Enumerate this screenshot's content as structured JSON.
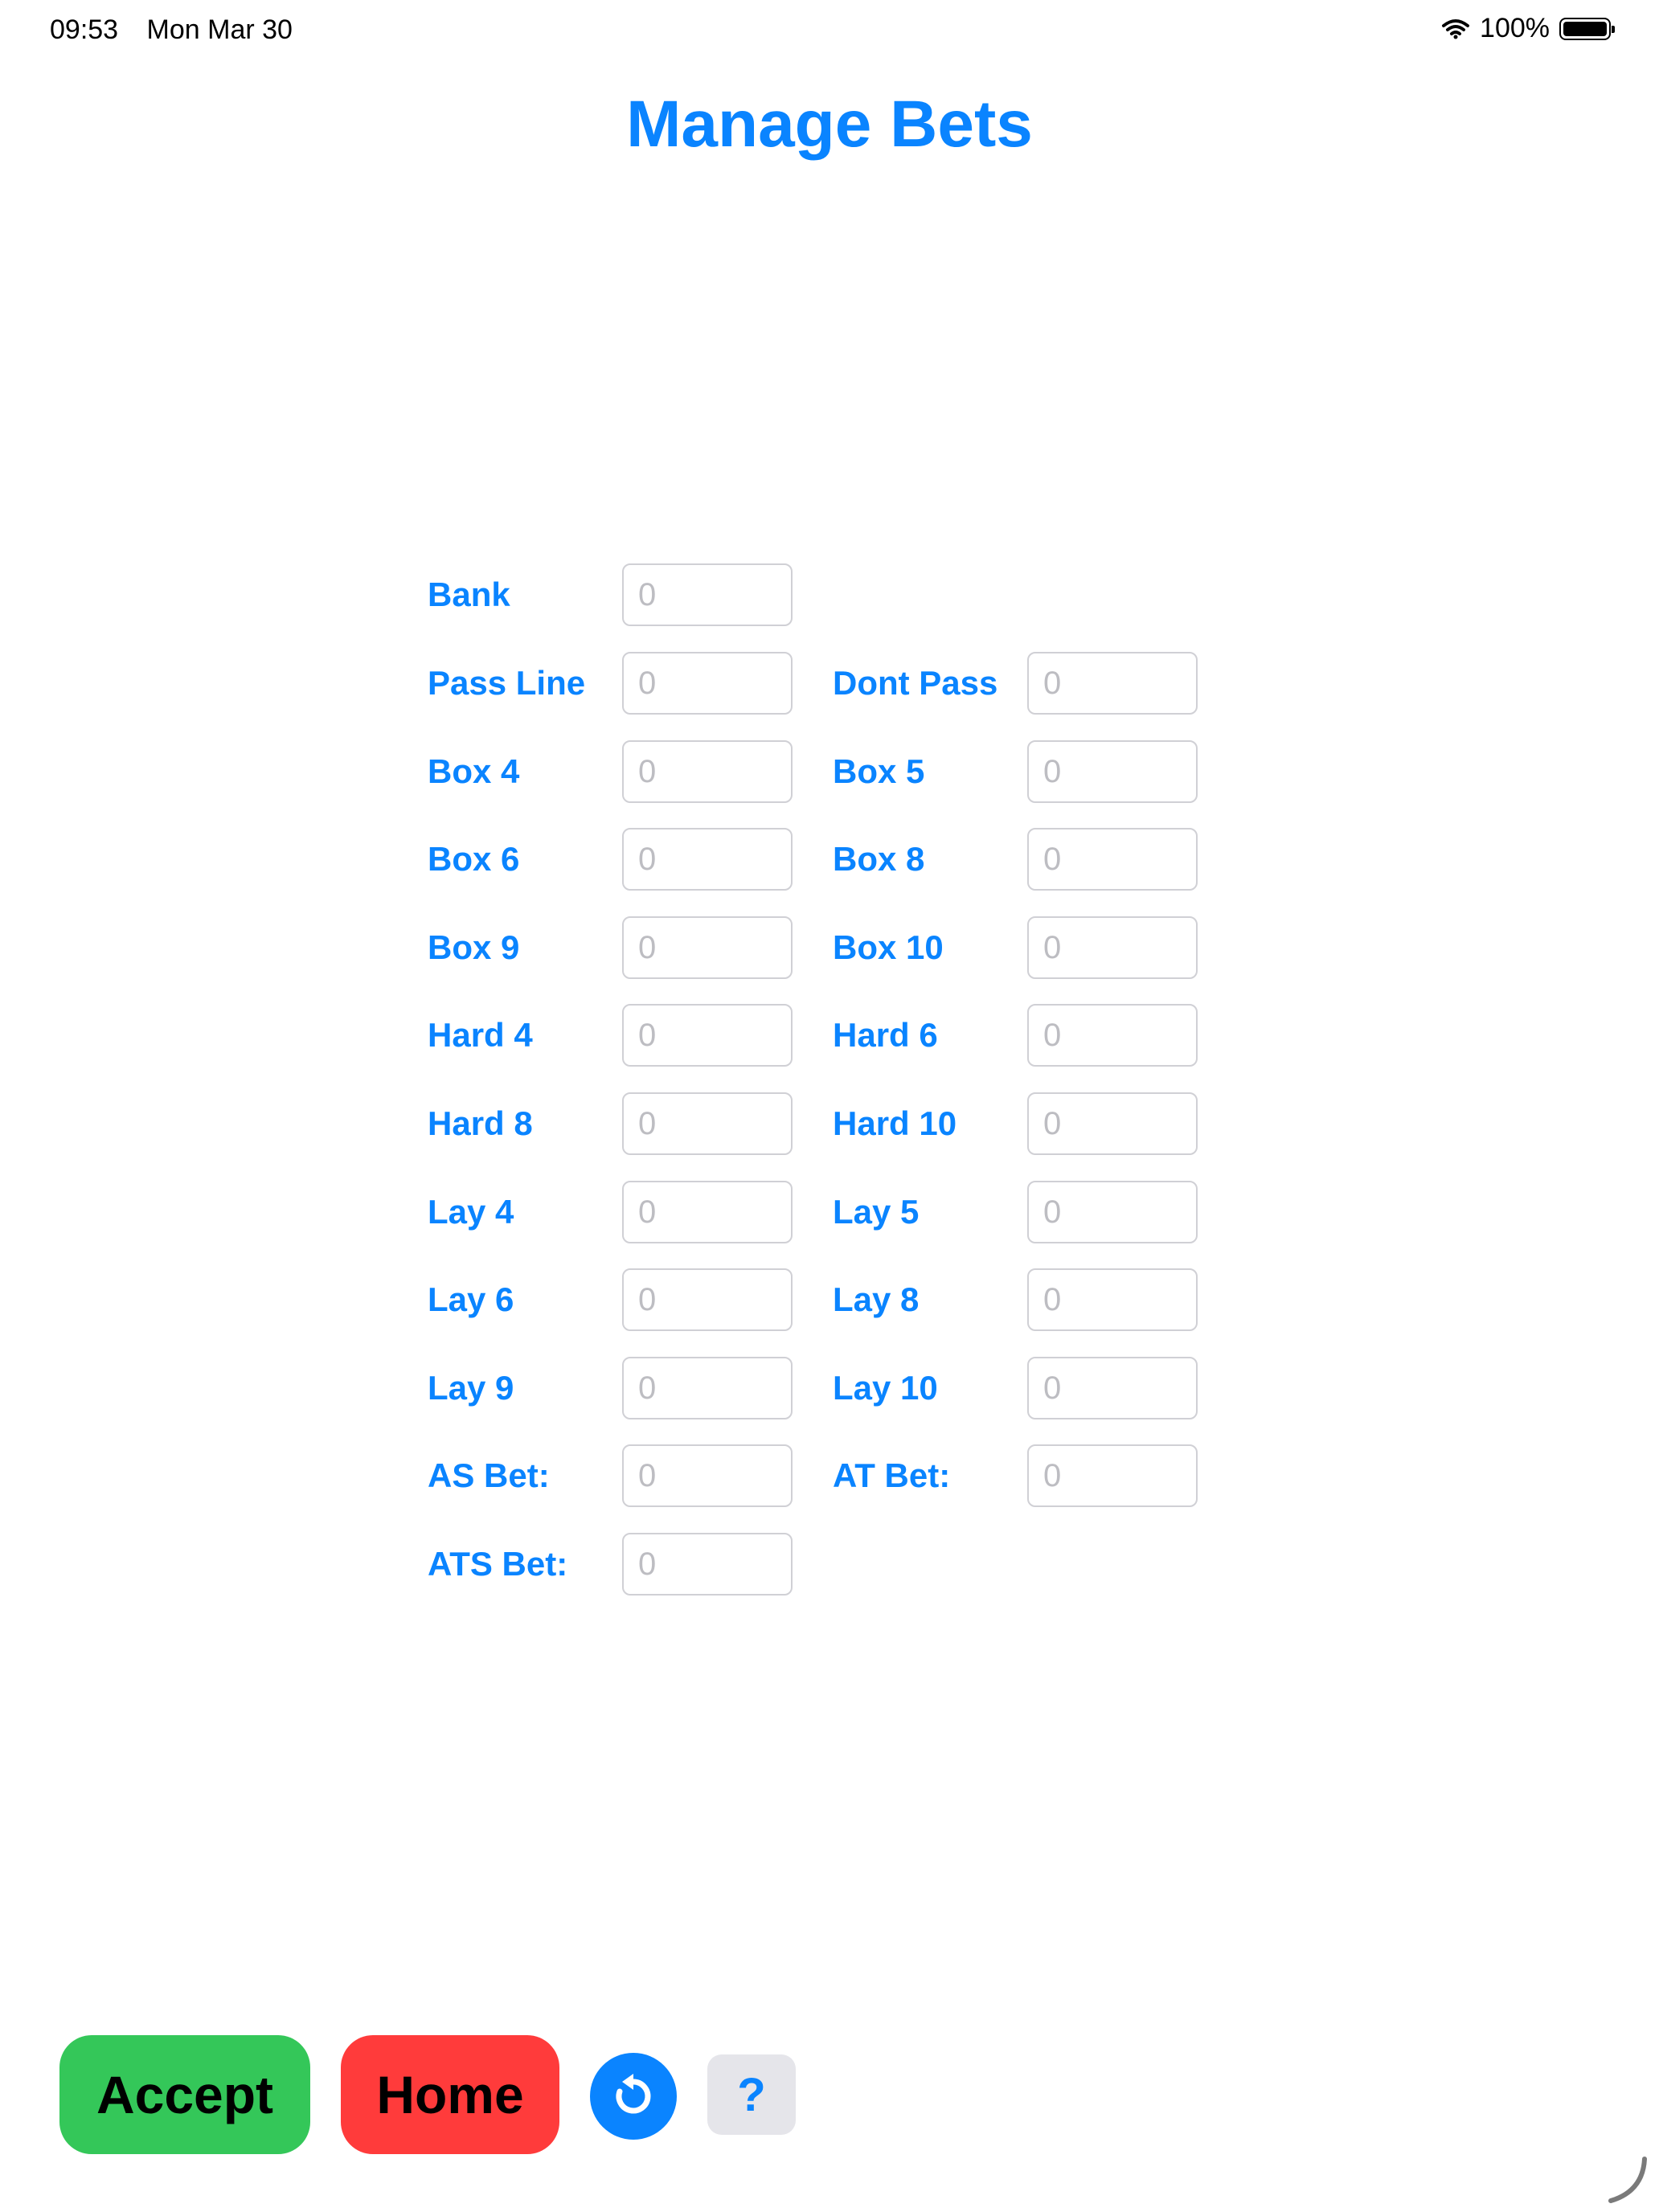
{
  "status_bar": {
    "time": "09:53",
    "date": "Mon Mar 30",
    "battery": "100%"
  },
  "title": "Manage Bets",
  "bets": {
    "bank": {
      "label": "Bank",
      "placeholder": "0"
    },
    "pass_line": {
      "label": "Pass Line",
      "placeholder": "0"
    },
    "dont_pass": {
      "label": "Dont Pass",
      "placeholder": "0"
    },
    "box4": {
      "label": "Box 4",
      "placeholder": "0"
    },
    "box5": {
      "label": "Box 5",
      "placeholder": "0"
    },
    "box6": {
      "label": "Box 6",
      "placeholder": "0"
    },
    "box8": {
      "label": "Box 8",
      "placeholder": "0"
    },
    "box9": {
      "label": "Box 9",
      "placeholder": "0"
    },
    "box10": {
      "label": "Box 10",
      "placeholder": "0"
    },
    "hard4": {
      "label": "Hard 4",
      "placeholder": "0"
    },
    "hard6": {
      "label": "Hard 6",
      "placeholder": "0"
    },
    "hard8": {
      "label": "Hard 8",
      "placeholder": "0"
    },
    "hard10": {
      "label": "Hard 10",
      "placeholder": "0"
    },
    "lay4": {
      "label": "Lay 4",
      "placeholder": "0"
    },
    "lay5": {
      "label": "Lay 5",
      "placeholder": "0"
    },
    "lay6": {
      "label": "Lay 6",
      "placeholder": "0"
    },
    "lay8": {
      "label": "Lay 8",
      "placeholder": "0"
    },
    "lay9": {
      "label": "Lay 9",
      "placeholder": "0"
    },
    "lay10": {
      "label": "Lay 10",
      "placeholder": "0"
    },
    "as_bet": {
      "label": "AS Bet:",
      "placeholder": "0"
    },
    "at_bet": {
      "label": "AT Bet:",
      "placeholder": "0"
    },
    "ats_bet": {
      "label": "ATS Bet:",
      "placeholder": "0"
    }
  },
  "buttons": {
    "accept": "Accept",
    "home": "Home",
    "help": "?"
  },
  "icons": {
    "reset": "rotate-ccw-icon",
    "wifi": "wifi-icon",
    "battery": "battery-icon",
    "grabber": "corner-grabber-icon"
  },
  "colors": {
    "accent": "#0A84FF",
    "accept": "#34C759",
    "home": "#FF3B3B",
    "help_bg": "#E5E5EA"
  }
}
